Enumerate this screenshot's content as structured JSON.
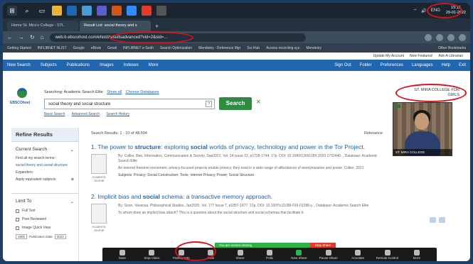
{
  "colors": {
    "ebsco_blue": "#2266b0",
    "search_green": "#2e8b3f",
    "annotation_red": "#d4151a",
    "link_blue": "#1f5fa8"
  },
  "taskbar": {
    "icons": [
      "windows-icon",
      "search-icon",
      "task-view-icon",
      "explorer-icon",
      "chrome-icon",
      "mail-icon",
      "teams-icon",
      "app-icon",
      "zoom-icon",
      "store-icon",
      "settings-icon"
    ],
    "wifi": "⌔",
    "sound": "🔊",
    "lang": "ENG",
    "time": "15:15",
    "date": "29-01-2022"
  },
  "browser": {
    "tabs": [
      {
        "label": "Home St. Mira's College - STL"
      },
      {
        "label": "Result List: social theory and s"
      }
    ],
    "url": "web.b.ebscohost.com/ehost/resultsadvanced?vid=2&sid=…",
    "bookmarks": [
      "Getting Started",
      "INFLIBNET NLIST",
      "Google",
      "eBook",
      "Gmail",
      "INFLIBNET e-Sodh",
      "Search Optimization",
      "Mendeley - Reference Mgr",
      "Sci-Hub",
      "Access recording sys",
      "Mendeley",
      "All Bookmarks"
    ],
    "bookmarks_right": "Other Bookmarks"
  },
  "ebsco": {
    "top_links": [
      "Update My Account",
      "New Features!",
      "Ask-A-Librarian"
    ],
    "toolbar": [
      "New Search",
      "Subjects",
      "Publications",
      "Images",
      "Indexes",
      "More"
    ],
    "toolbar_right": [
      "Sign Out",
      "Folder",
      "Preferences",
      "Languages",
      "Help",
      "Exit"
    ],
    "logo_text": "EBSCOhost",
    "searching_label": "Searching: Academic Search Elite",
    "show_all": "Show all",
    "choose_db": "Choose Databases",
    "search_query": "social theory and social structure",
    "search_button": "Search",
    "search_clear": "✕",
    "search_links": [
      "Basic Search",
      "Advanced Search",
      "Search History"
    ],
    "college": [
      "ST. MIRA COLLEGE FOR",
      "GIRLS"
    ]
  },
  "sidebar": {
    "refine": "Refine Results",
    "current_search": "Current Search",
    "find_all": "Find all my search terms:",
    "query_link": "social theory and social structure",
    "expanders": "Expanders",
    "equivalent": "Apply equivalent subjects",
    "limit_to": "Limit To",
    "full_text": "Full Text",
    "peer_reviewed": "Peer Reviewed",
    "image_quick_view": "Image Quick View",
    "pub_date": "Publication Date",
    "pub_start": "1900",
    "pub_end": "2022"
  },
  "results": {
    "count": "Search Results: 1 - 10 of 48,594",
    "relevance": "Relevance",
    "items": [
      {
        "num": "1.",
        "title_pre": "The power to ",
        "title_b1": "structure",
        "title_mid": ": exploring ",
        "title_b2": "social",
        "title_post": " worlds of privacy, technology and power in the Tor Project.",
        "meta": "By: Collier, Ben. Information, Communication & Society. Sep2021, Vol. 24 Issue 12, p1728-1744. 17p. DOI: 10.1080/1369118X.2020.1732440. , Database: Academic Search Elite",
        "abstract": "An internet freedom movement, privacy-focused projects enable privacy; they exist in a wide range of affordances of anonymization and power. Collier, 2021",
        "subjects": "Subjects: Privacy; Social Construction; Tools; Internet Privacy; Power; Social Structure",
        "thumb_label": "Academic Journal"
      },
      {
        "num": "2.",
        "title_pre": "Implicit bias and ",
        "title_b1": "social",
        "title_mid": " schema: a transactive memory approach.",
        "title_b2": "",
        "title_post": "",
        "meta": "By: Soon, Vanessa. Philosophical Studies. Jan2020, Vol. 177 Issue 7, p1857-1877. 21p. DOI: 10.1007/s11098-019-01288-y. , Database: Academic Search Elite",
        "abstract": "To whom does an implicit bias attach? This is a question about the social structure and social schemas that facilitate it.",
        "subjects": "",
        "thumb_label": "Academic Journal"
      }
    ]
  },
  "video": {
    "name": "ST. MIRA COLLEGE"
  },
  "zoom": {
    "buttons": [
      "Mute",
      "Stop Video",
      "Participants",
      "Chat",
      "Share",
      "Polls",
      "New Share",
      "Pause Share",
      "Annotate",
      "Remote Control",
      "More"
    ],
    "participants_count": "33",
    "share_status": "You are screen sharing",
    "stop_share": "Stop Share"
  }
}
